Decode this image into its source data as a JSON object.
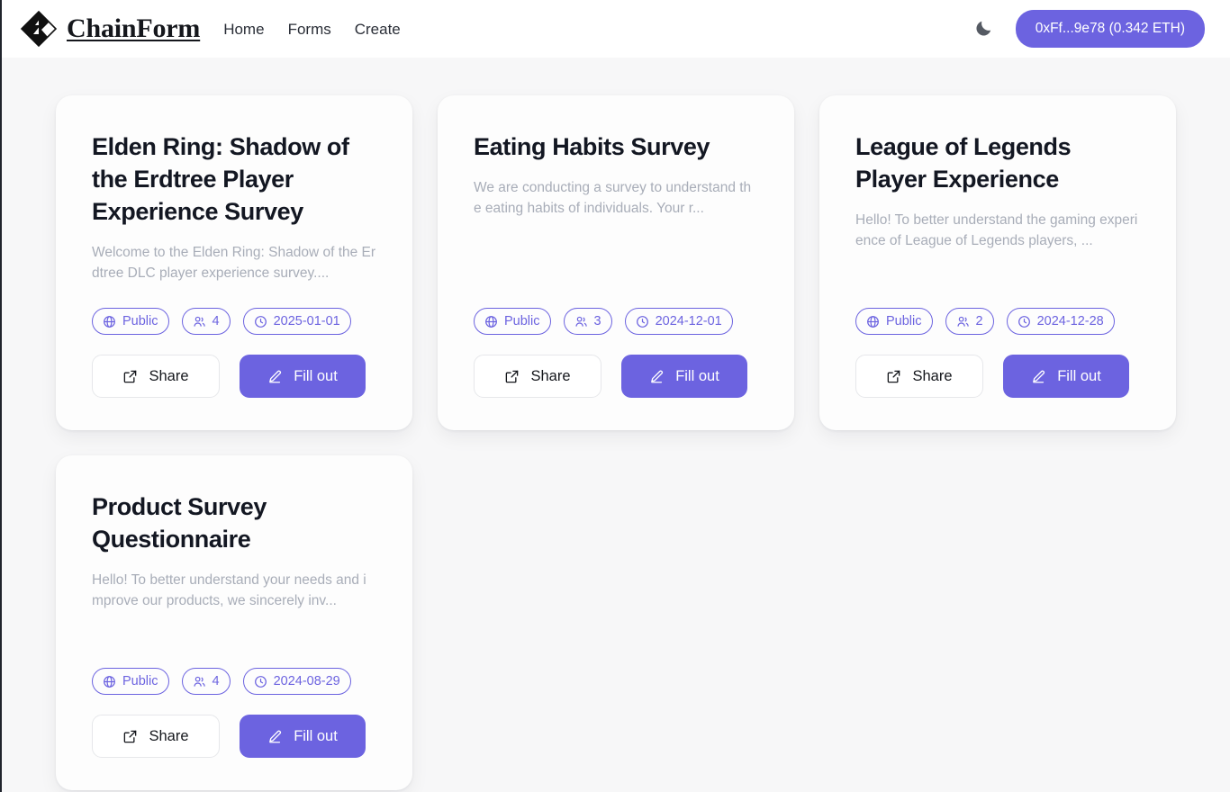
{
  "header": {
    "brand_name": "ChainForm",
    "brand_icon": "chainform-diamond-bolt-logo",
    "nav": [
      {
        "label": "Home"
      },
      {
        "label": "Forms"
      },
      {
        "label": "Create"
      }
    ],
    "theme_toggle_icon": "moon-icon",
    "wallet_label": "0xFf...9e78 (0.342 ETH)"
  },
  "colors": {
    "accent": "#6c63e0",
    "page_background": "#f7f7f8",
    "card_background": "#fdfdfd",
    "title_text": "#131722",
    "muted_text": "#a8adb8"
  },
  "labels": {
    "share": "Share",
    "fill_out": "Fill out",
    "share_icon": "external-link-icon",
    "fill_out_icon": "pencil-edit-icon",
    "visibility_icon": "globe-icon",
    "responses_icon": "users-icon",
    "date_icon": "clock-icon"
  },
  "cards": [
    {
      "title": "Elden Ring: Shadow of the Erdtree Player Experience Survey",
      "description": "Welcome to the Elden Ring: Shadow of the Erdtree DLC player experience survey....",
      "visibility": "Public",
      "responses": "4",
      "date": "2025-01-01"
    },
    {
      "title": "Eating Habits Survey",
      "description": "We are conducting a survey to understand the eating habits of individuals. Your r...",
      "visibility": "Public",
      "responses": "3",
      "date": "2024-12-01"
    },
    {
      "title": "League of Legends Player Experience",
      "description": "Hello! To better understand the gaming experience of League of Legends players, ...",
      "visibility": "Public",
      "responses": "2",
      "date": "2024-12-28"
    },
    {
      "title": "Product Survey Questionnaire",
      "description": "Hello! To better understand your needs and improve our products, we sincerely inv...",
      "visibility": "Public",
      "responses": "4",
      "date": "2024-08-29"
    }
  ]
}
